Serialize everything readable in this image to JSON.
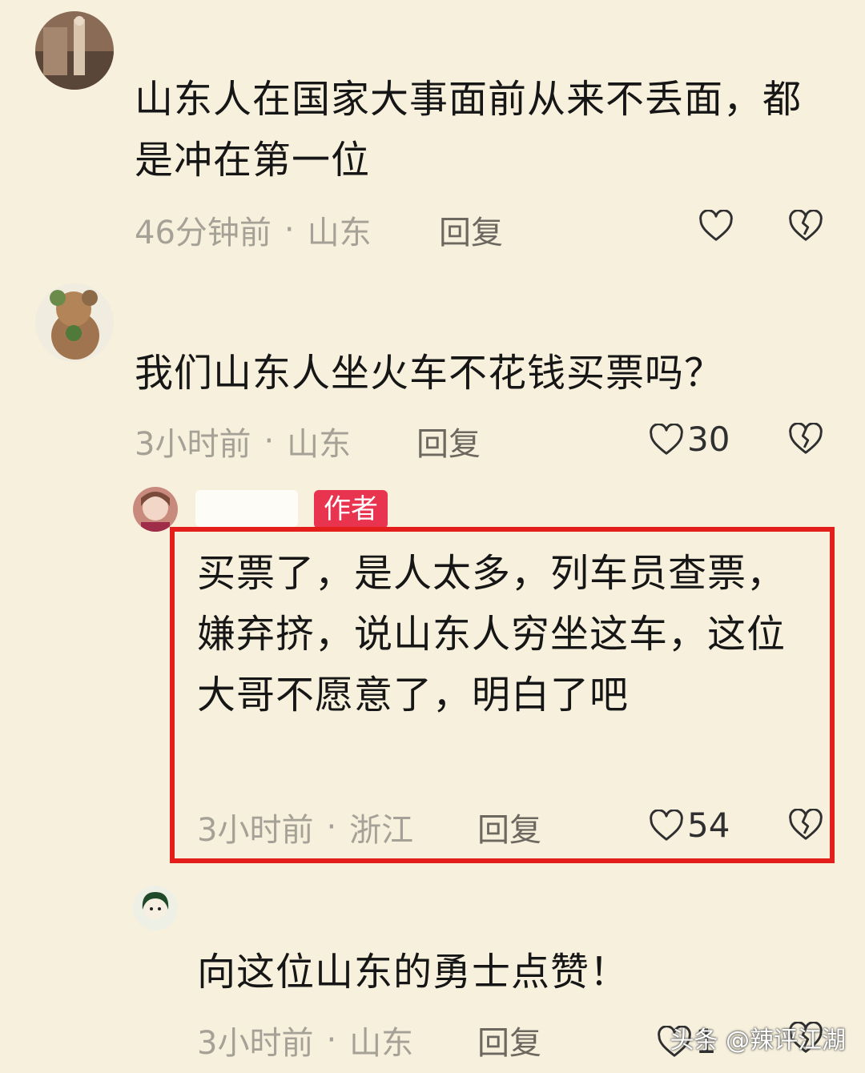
{
  "comments": [
    {
      "text": "山东人在国家大事面前从来不丢面，都是冲在第一位",
      "time": "46分钟前",
      "location": "山东",
      "reply_label": "回复",
      "likes": ""
    },
    {
      "text": "我们山东人坐火车不花钱买票吗？",
      "time": "3小时前",
      "location": "山东",
      "reply_label": "回复",
      "likes": "30"
    },
    {
      "author_badge": "作者",
      "text": "买票了，是人太多，列车员查票，嫌弃挤，说山东人穷坐这车，这位大哥不愿意了，明白了吧",
      "time": "3小时前",
      "location": "浙江",
      "reply_label": "回复",
      "likes": "54"
    },
    {
      "text": "向这位山东的勇士点赞！",
      "time": "3小时前",
      "location": "山东",
      "reply_label": "回复",
      "likes": "1"
    }
  ],
  "separator": "·",
  "watermark": "头条 @辣评江湖",
  "colors": {
    "background": "#f6f0dd",
    "badge": "#e8344e",
    "highlight_border": "#e41e1b",
    "meta_text": "#a6a196"
  },
  "icons": {
    "like": "heart-outline-icon",
    "dislike": "broken-heart-icon"
  }
}
